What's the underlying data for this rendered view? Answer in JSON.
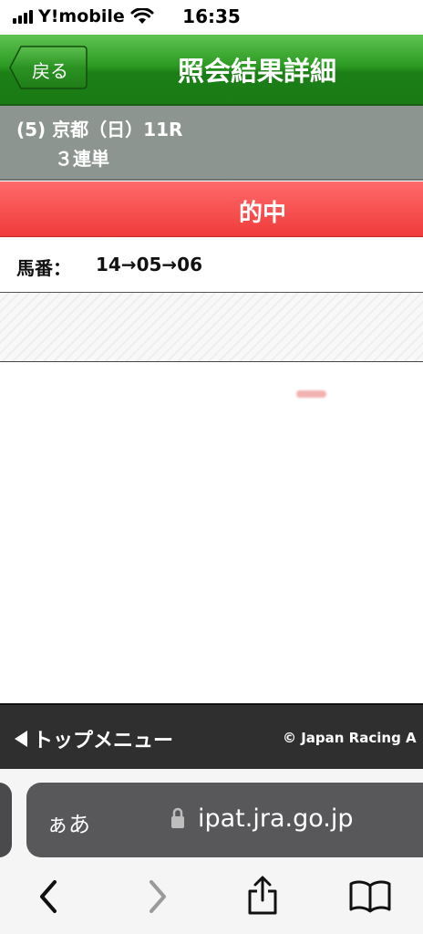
{
  "status_bar": {
    "carrier": "Y!mobile",
    "time": "16:35"
  },
  "header": {
    "back_label": "戻る",
    "title": "照会結果詳細"
  },
  "race": {
    "line1": "(5) 京都（日）11R",
    "line2": "３連単"
  },
  "result": {
    "label": "的中"
  },
  "horse_numbers": {
    "label": "馬番：",
    "value": "14→05→06"
  },
  "footer": {
    "top_menu": "トップメニュー",
    "copyright": "© Japan Racing A"
  },
  "browser": {
    "aa_label": "ぁあ",
    "url": "ipat.jra.go.jp"
  },
  "icons": {
    "back": "chevron-left-icon",
    "forward": "chevron-right-icon",
    "share": "share-icon",
    "bookmarks": "book-icon",
    "lock": "lock-icon",
    "wifi": "wifi-icon",
    "signal": "signal-icon"
  },
  "colors": {
    "header_green": "#2c9a23",
    "hit_red": "#f03b3b",
    "race_gray": "#8d9590",
    "footer_dark": "#2f2f2f"
  }
}
